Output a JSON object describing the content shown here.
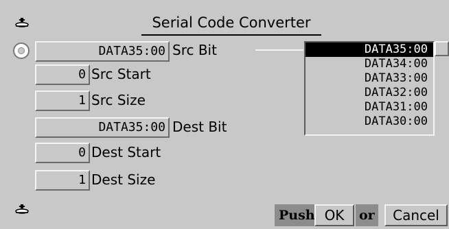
{
  "window": {
    "title": "Serial Code Converter"
  },
  "rows": [
    {
      "value": "DATA35:00",
      "label": "Src Bit"
    },
    {
      "value": "0",
      "label": "Src Start"
    },
    {
      "value": "1",
      "label": "Src Size"
    },
    {
      "value": "DATA35:00",
      "label": "Dest Bit"
    },
    {
      "value": "0",
      "label": "Dest Start"
    },
    {
      "value": "1",
      "label": "Dest Size"
    }
  ],
  "list": {
    "items": [
      "DATA35:00",
      "DATA34:00",
      "DATA33:00",
      "DATA32:00",
      "DATA31:00",
      "DATA30:00"
    ],
    "selected": "DATA35:00"
  },
  "footer": {
    "push_label": "Push",
    "ok_label": "OK",
    "or_label": "or",
    "cancel_label": "Cancel"
  },
  "colors": {
    "window_bg": "#c8c8c8",
    "selection_bg": "#000000",
    "selection_fg": "#ffffff",
    "label_bg": "#8c8c8c"
  },
  "icons": {
    "pin_top": "pushpin-icon",
    "pin_bottom": "pushpin-icon",
    "radio": "radio-button-icon"
  }
}
